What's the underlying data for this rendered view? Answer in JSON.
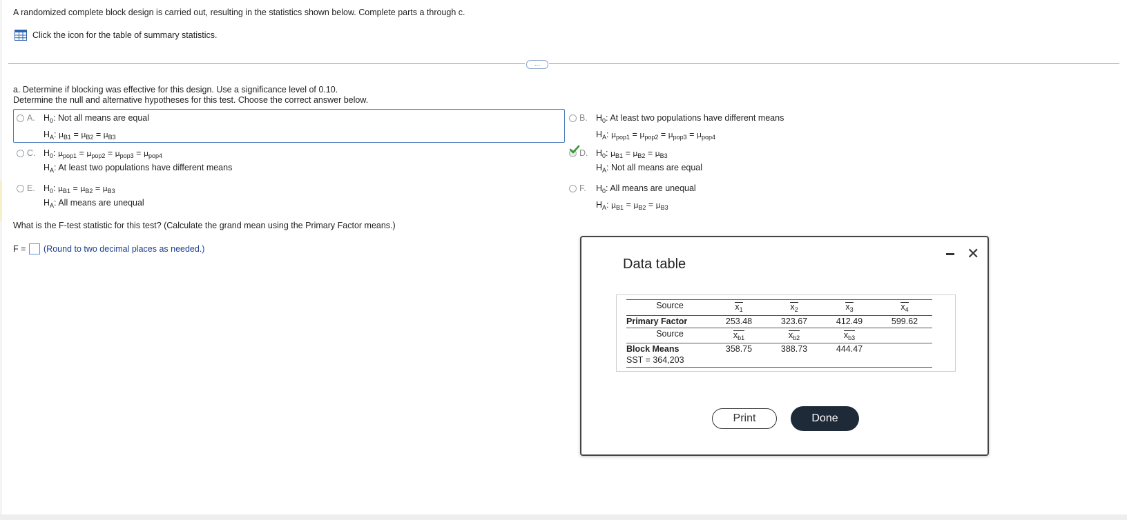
{
  "intro": "A randomized complete block design is carried out, resulting in the statistics shown below. Complete parts a through c.",
  "stats_link": "Click the icon for the table of summary statistics.",
  "expander_label": "…",
  "part_a": {
    "line1": "a. Determine if blocking was effective for this design. Use a significance level of 0.10.",
    "line2": "Determine the null and alternative hypotheses for this test. Choose the correct answer below."
  },
  "options": {
    "A": {
      "letter": "A.",
      "h0_text": "Not all means are equal"
    },
    "B": {
      "letter": "B.",
      "h0_text": "At least two populations have different means"
    },
    "C": {
      "letter": "C.",
      "ha_text": "At least two populations have different means"
    },
    "D": {
      "letter": "D.",
      "ha_text": "Not all means are equal"
    },
    "E": {
      "letter": "E.",
      "ha_text": "All means are unequal"
    },
    "F": {
      "letter": "F.",
      "h0_text": "All means are unequal"
    }
  },
  "symbols": {
    "h0": "H",
    "h0_sub": "0",
    "ha": "H",
    "ha_sub": "A",
    "mu": "μ",
    "eq": "=",
    "colon": ":",
    "b1": "B1",
    "b2": "B2",
    "b3": "B3",
    "pop1": "pop1",
    "pop2": "pop2",
    "pop3": "pop3",
    "pop4": "pop4"
  },
  "f_question": "What is the F-test statistic for this test? (Calculate the grand mean using the Primary Factor means.)",
  "f_label": "F =",
  "f_value": "",
  "f_hint": "(Round to two decimal places as needed.)",
  "correct_option": "D",
  "check_color": "#2e9b2e",
  "dialog": {
    "title": "Data table",
    "print_label": "Print",
    "done_label": "Done",
    "table": {
      "source_label": "Source",
      "primary_factor_label": "Primary Factor",
      "block_means_label": "Block Means",
      "sst_label": "SST = 364,203",
      "xbar_headers": [
        {
          "x": "x",
          "sub": "1"
        },
        {
          "x": "x",
          "sub": "2"
        },
        {
          "x": "x",
          "sub": "3"
        },
        {
          "x": "x",
          "sub": "4"
        }
      ],
      "primary_values": [
        "253.48",
        "323.67",
        "412.49",
        "599.62"
      ],
      "block_headers": [
        {
          "x": "x",
          "sub": "b1"
        },
        {
          "x": "x",
          "sub": "b2"
        },
        {
          "x": "x",
          "sub": "b3"
        }
      ],
      "block_values": [
        "358.75",
        "388.73",
        "444.47"
      ]
    }
  }
}
